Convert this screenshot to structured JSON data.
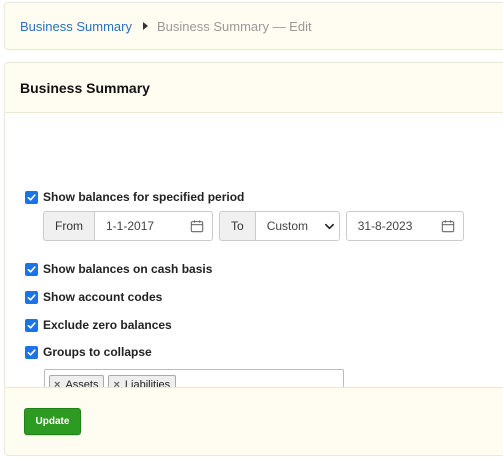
{
  "breadcrumb": {
    "parent": "Business Summary",
    "current": "Business Summary — Edit"
  },
  "panel": {
    "title": "Business Summary"
  },
  "options": {
    "specified_period": {
      "label": "Show balances for specified period",
      "checked": true
    },
    "from_label": "From",
    "from_date": "1-1-2017",
    "to_label": "To",
    "to_select": "Custom",
    "to_date": "31-8-2023",
    "cash_basis": {
      "label": "Show balances on cash basis",
      "checked": true
    },
    "account_codes": {
      "label": "Show account codes",
      "checked": true
    },
    "exclude_zero": {
      "label": "Exclude zero balances",
      "checked": true
    },
    "groups_collapse": {
      "label": "Groups to collapse",
      "checked": true
    },
    "tags": [
      "Assets",
      "Liabilities"
    ]
  },
  "footer": {
    "update_label": "Update"
  },
  "colors": {
    "accent": "#1a73e8",
    "button": "#2d9b22",
    "link": "#2a6fbf",
    "panel_bg": "#fffdf2"
  },
  "icons": {
    "checkbox": "checkmark-icon",
    "calendar": "calendar-icon",
    "select": "chevron-down-icon",
    "tag_remove": "remove-icon",
    "breadcrumb_sep": "triangle-right-icon"
  }
}
